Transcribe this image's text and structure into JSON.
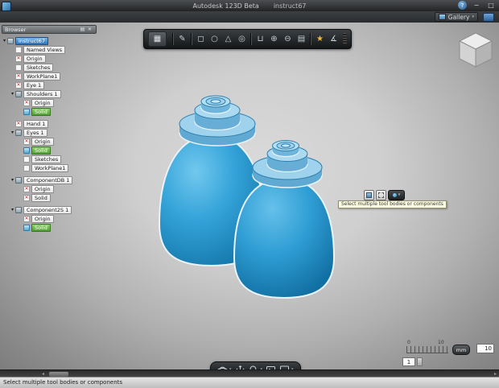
{
  "window": {
    "title": "Autodesk 123D Beta",
    "doc": "instruct67"
  },
  "icons": {
    "question": "?",
    "minimize": "−",
    "restore": "□",
    "caret": "▾",
    "expand": "▾",
    "x": "✕",
    "menu_grid": "▦",
    "browser_menu": "▤",
    "browser_close": "✕",
    "left_arrow": "◂",
    "right_arrow": "▸"
  },
  "menubar": {
    "gallery": "Gallery"
  },
  "browser": {
    "header": "Browser",
    "items": [
      {
        "label": "instruct67"
      },
      {
        "label": "Named Views"
      },
      {
        "label": "Origin"
      },
      {
        "label": "Sketches"
      },
      {
        "label": "WorkPlane1"
      },
      {
        "label": "Eye 1"
      },
      {
        "label": "Shoulders 1"
      },
      {
        "label": "Origin"
      },
      {
        "label": "Solid"
      },
      {
        "label": "Hand 1"
      },
      {
        "label": "Eyes 1"
      },
      {
        "label": "Origin"
      },
      {
        "label": "Solid"
      },
      {
        "label": "Sketches"
      },
      {
        "label": "WorkPlane1"
      },
      {
        "label": "ComponentDB 1"
      },
      {
        "label": "Origin"
      },
      {
        "label": "Solid"
      },
      {
        "label": "Component2S 1"
      },
      {
        "label": "Origin"
      },
      {
        "label": "Solid"
      }
    ]
  },
  "toolbar": {
    "icons": [
      {
        "name": "sketch",
        "glyph": "✎"
      },
      {
        "name": "primitive-box",
        "glyph": "◻"
      },
      {
        "name": "primitive-sphere",
        "glyph": "○"
      },
      {
        "name": "primitive-cone",
        "glyph": "△"
      },
      {
        "name": "revolve",
        "glyph": "◎"
      },
      {
        "name": "shell",
        "glyph": "⊔"
      },
      {
        "name": "combine",
        "glyph": "⊕"
      },
      {
        "name": "subtract",
        "glyph": "⊖"
      },
      {
        "name": "pattern",
        "glyph": "▤"
      },
      {
        "name": "material",
        "glyph": "★"
      },
      {
        "name": "measure",
        "glyph": "∡"
      }
    ]
  },
  "selection_toolbar": {
    "tooltip": "Select multiple tool bodies or components"
  },
  "scale_widget": {
    "tick_min": "0",
    "tick_max": "10",
    "unit": "mm",
    "major": "10",
    "minor": "1"
  },
  "statusbar": {
    "message": "Select multiple tool bodies or components"
  },
  "colors": {
    "model_blue": "#2e9fd4",
    "solid_green": "#4f9e34",
    "selection_blue": "#2f72b8"
  }
}
